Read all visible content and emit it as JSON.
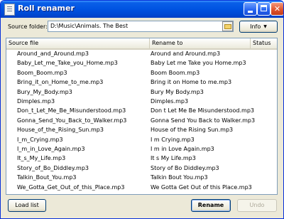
{
  "window": {
    "title": "Roll renamer"
  },
  "titlebar_buttons": {
    "minimize": "minimize-icon",
    "maximize": "maximize-icon",
    "close": "close-icon"
  },
  "toolbar": {
    "source_label": "Source folder:",
    "source_path": "D:\\Music\\Animals. The Best",
    "browse_icon": "folder-icon",
    "info_label": "Info",
    "info_caret": "▼"
  },
  "table": {
    "columns": [
      "Source file",
      "Rename to",
      "Status"
    ],
    "rows": [
      {
        "source": "Around_and_Around.mp3",
        "rename": "Around and Around.mp3",
        "status": ""
      },
      {
        "source": "Baby_Let_me_Take_you_Home.mp3",
        "rename": "Baby Let me Take you Home.mp3",
        "status": ""
      },
      {
        "source": "Boom_Boom.mp3",
        "rename": "Boom Boom.mp3",
        "status": ""
      },
      {
        "source": "Bring_it_on_Home_to_me.mp3",
        "rename": "Bring it on Home to me.mp3",
        "status": ""
      },
      {
        "source": "Bury_My_Body.mp3",
        "rename": "Bury My Body.mp3",
        "status": ""
      },
      {
        "source": "Dimples.mp3",
        "rename": "Dimples.mp3",
        "status": ""
      },
      {
        "source": "Don_t_Let_Me_Be_Misunderstood.mp3",
        "rename": "Don t Let Me Be Misunderstood.mp3",
        "status": ""
      },
      {
        "source": "Gonna_Send_You_Back_to_Walker.mp3",
        "rename": "Gonna Send You Back to Walker.mp3",
        "status": ""
      },
      {
        "source": "House_of_the_Rising_Sun.mp3",
        "rename": "House of the Rising Sun.mp3",
        "status": ""
      },
      {
        "source": "I_m_Crying.mp3",
        "rename": "I m Crying.mp3",
        "status": ""
      },
      {
        "source": "I_m_in_Love_Again.mp3",
        "rename": "I m in Love Again.mp3",
        "status": ""
      },
      {
        "source": "It_s_My_Life.mp3",
        "rename": "It s My Life.mp3",
        "status": ""
      },
      {
        "source": "Story_of_Bo_Diddley.mp3",
        "rename": "Story of Bo Diddley.mp3",
        "status": ""
      },
      {
        "source": "Talkin_Bout_You.mp3",
        "rename": "Talkin Bout You.mp3",
        "status": ""
      },
      {
        "source": "We_Gotta_Get_Out_of_this_Place.mp3",
        "rename": "We Gotta Get Out of this Place.mp3",
        "status": ""
      }
    ]
  },
  "buttons": {
    "load_list": "Load list",
    "rename": "Rename",
    "undo": "Undo"
  }
}
